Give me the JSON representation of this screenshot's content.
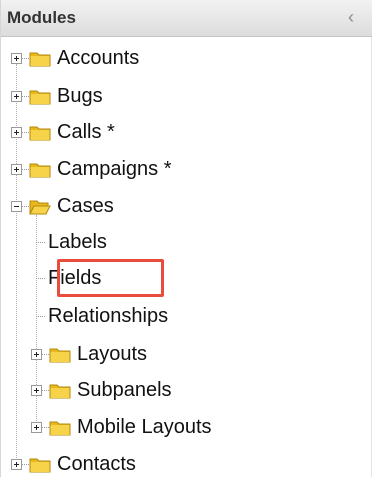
{
  "panel": {
    "title": "Modules",
    "collapse_icon": "‹"
  },
  "tree": {
    "accounts": "Accounts",
    "bugs": "Bugs",
    "calls": "Calls *",
    "campaigns": "Campaigns *",
    "cases": "Cases",
    "cases_children": {
      "labels": "Labels",
      "fields": "Fields",
      "relationships": "Relationships",
      "layouts": "Layouts",
      "subpanels": "Subpanels",
      "mobile_layouts": "Mobile Layouts"
    },
    "contacts": "Contacts"
  },
  "colors": {
    "highlight": "#e74c3c",
    "folder": "#f4c430"
  }
}
